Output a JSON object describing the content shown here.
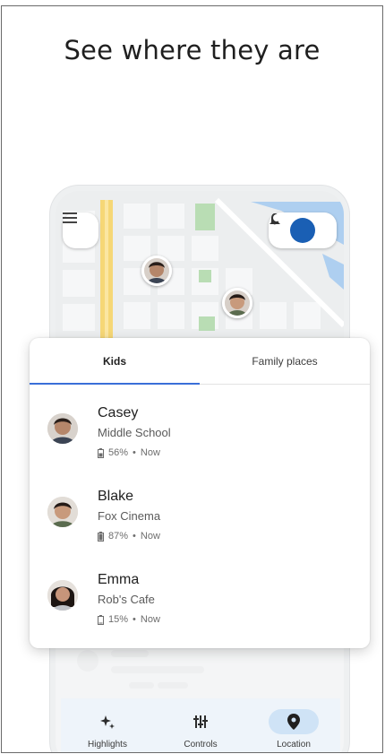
{
  "headline": "See where they are",
  "tabs": [
    {
      "label": "Kids",
      "active": true
    },
    {
      "label": "Family places",
      "active": false
    }
  ],
  "kids": [
    {
      "name": "Casey",
      "place": "Middle School",
      "battery": "56%",
      "time": "Now",
      "skin": "#b5866a",
      "hair": "#2a1f1a"
    },
    {
      "name": "Blake",
      "place": "Fox Cinema",
      "battery": "87%",
      "time": "Now",
      "skin": "#c89a7c",
      "hair": "#241a16"
    },
    {
      "name": "Emma",
      "place": "Rob's Cafe",
      "battery": "15%",
      "time": "Now",
      "skin": "#c7957a",
      "hair": "#1d1512"
    }
  ],
  "separator": "•",
  "nav": [
    {
      "label": "Highlights",
      "icon": "sparkle-icon",
      "active": false
    },
    {
      "label": "Controls",
      "icon": "sliders-icon",
      "active": false
    },
    {
      "label": "Location",
      "icon": "location-pin-icon",
      "active": true
    }
  ],
  "colors": {
    "accent": "#3a6fd8",
    "map_road_yellow": "#f6d776",
    "map_park": "#b9ddb4",
    "map_water": "#aecff0"
  }
}
